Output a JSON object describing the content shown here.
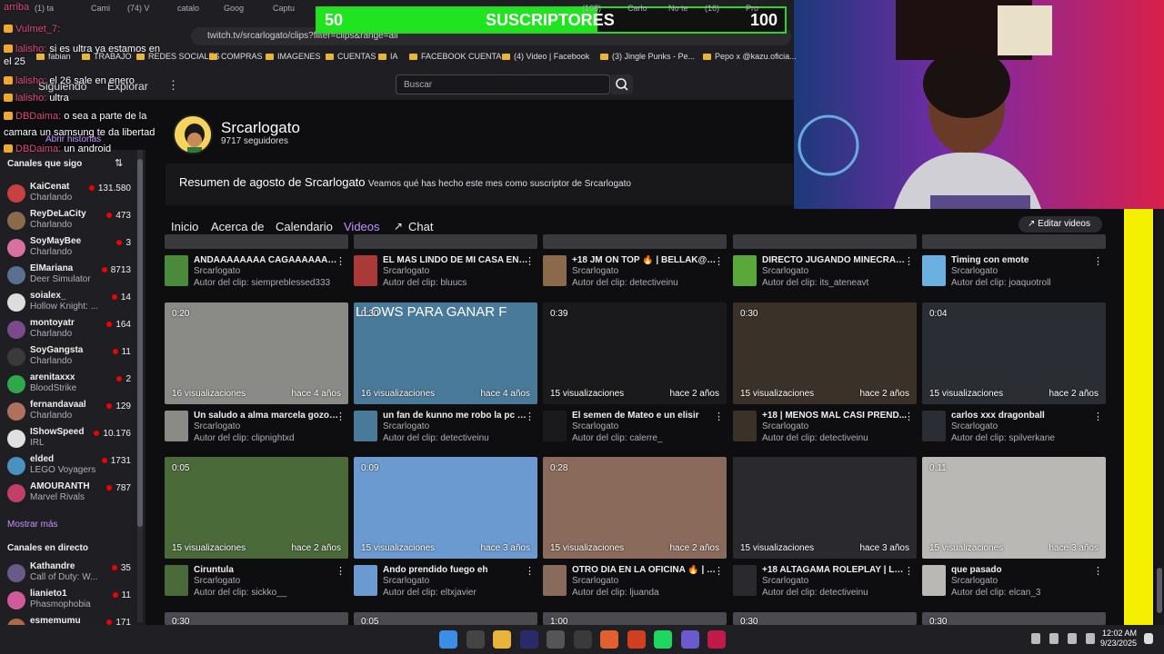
{
  "browser": {
    "tabs": [
      "(1) ta",
      "Cami",
      "(74) V",
      "catalo",
      "Goog",
      "Captu",
      "(108)",
      "Carlo",
      "No te",
      "(16)",
      "Pro"
    ],
    "url": "twitch.tv/srcarlogato/clips?filter=clips&range=all",
    "bookmarks": [
      "fabian",
      "TRABAJO",
      "REDES SOCIALES",
      "COMPRAS",
      "IMAGENES",
      "CUENTAS",
      "IA",
      "FACEBOOK CUENTA...",
      "(4) Video | Facebook",
      "(3) Jingle Punks - Pe...",
      "Pepo x @kazu.oficia..."
    ]
  },
  "subs_bar": {
    "left": "50",
    "center": "SUSCRIPTORES",
    "right": "100",
    "progress": 0.6
  },
  "chat": [
    {
      "user": "arriba",
      "msg": "",
      "badge": false
    },
    {
      "user": "Vulmet_7:",
      "msg": "",
      "badge": true
    },
    {
      "user": "lalisho:",
      "msg": "si es ultra ya estamos en",
      "badge": true
    },
    {
      "user": "",
      "msg": "el 25",
      "badge": false
    },
    {
      "user": "lalisho:",
      "msg": "el 26 sale en enero",
      "badge": true
    },
    {
      "user": "lalisho:",
      "msg": "ultra",
      "badge": true
    },
    {
      "user": "DBDaima:",
      "msg": "o sea a parte de la",
      "badge": true
    },
    {
      "user": "",
      "msg": "camara un samsung te da libertad",
      "badge": false
    },
    {
      "user": "DBDaima:",
      "msg": "un android",
      "badge": true
    }
  ],
  "nav_stub": {
    "following": "Siguiendo",
    "explore": "Explorar",
    "stories": "Abrir historias"
  },
  "search": {
    "placeholder": "Buscar"
  },
  "channel": {
    "name": "Srcarlogato",
    "followers": "9717 seguidores"
  },
  "recap": {
    "title": "Resumen de agosto de Srcarlogato",
    "desc": "Veamos qué has hecho este mes como suscriptor de Srcarlogato"
  },
  "tabs": [
    "Inicio",
    "Acerca de",
    "Calendario",
    "Videos",
    "Chat"
  ],
  "edit_videos": "Editar videos",
  "sidebar": {
    "followed_title": "Canales que sigo",
    "followed": [
      {
        "name": "KaiCenat",
        "game": "Charlando",
        "viewers": "131.580",
        "color": "#c94040"
      },
      {
        "name": "ReyDeLaCity",
        "game": "Charlando",
        "viewers": "473",
        "color": "#8a6a4a"
      },
      {
        "name": "SoyMayBee",
        "game": "Charlando",
        "viewers": "3",
        "color": "#d870a0"
      },
      {
        "name": "ElMariana",
        "game": "Deer Simulator",
        "viewers": "8713",
        "color": "#5a7090"
      },
      {
        "name": "soialex_",
        "game": "Hollow Knight: ...",
        "viewers": "14",
        "color": "#dddddd"
      },
      {
        "name": "montoyatr",
        "game": "Charlando",
        "viewers": "164",
        "color": "#7a4a8a"
      },
      {
        "name": "SoyGangsta",
        "game": "Charlando",
        "viewers": "11",
        "color": "#3a3a3a"
      },
      {
        "name": "arenitaxxx",
        "game": "BloodStrike",
        "viewers": "2",
        "color": "#2ea84a"
      },
      {
        "name": "fernandavaal",
        "game": "Charlando",
        "viewers": "129",
        "color": "#b07060"
      },
      {
        "name": "IShowSpeed",
        "game": "IRL",
        "viewers": "10.176",
        "color": "#e0e0e0"
      },
      {
        "name": "elded",
        "game": "LEGO Voyagers",
        "viewers": "1731",
        "color": "#4a90c0"
      },
      {
        "name": "AMOURANTH",
        "game": "Marvel Rivals",
        "viewers": "787",
        "color": "#c0406a"
      }
    ],
    "show_more": "Mostrar más",
    "live_title": "Canales en directo",
    "live": [
      {
        "name": "Kathandre",
        "game": "Call of Duty: W...",
        "viewers": "35",
        "color": "#6a5a8a"
      },
      {
        "name": "lianieto1",
        "game": "Phasmophobia",
        "viewers": "11",
        "color": "#d05a9a"
      },
      {
        "name": "esmemumu",
        "game": "",
        "viewers": "171",
        "color": "#aa6a4a"
      }
    ]
  },
  "clips_top_row": [
    {
      "title": "ANDAAAAAAAA CAGAAAAAAAA...",
      "channel": "Srcarlogato",
      "by": "Autor del clip: siempreblessed333"
    },
    {
      "title": "EL MAS LINDO DE MI CASA EN T...",
      "channel": "Srcarlogato",
      "by": "Autor del clip: bluucs"
    },
    {
      "title": "+18 JM ON TOP 🔥 | BELLAK@S ...",
      "channel": "Srcarlogato",
      "by": "Autor del clip: detectiveinu"
    },
    {
      "title": "DIRECTO JUGANDO MINECRAF...",
      "channel": "Srcarlogato",
      "by": "Autor del clip: its_ateneavt"
    },
    {
      "title": "Timing con emote",
      "channel": "Srcarlogato",
      "by": "Autor del clip: joaquotroll"
    }
  ],
  "clips": [
    {
      "dur": "0:20",
      "views": "16 visualizaciones",
      "age": "hace 4 años",
      "title": "Un saludo a alma marcela gozo ...",
      "channel": "Srcarlogato",
      "by": "Autor del clip: clipnightxd",
      "bg": "#8a8a86"
    },
    {
      "dur": "0:30",
      "views": "16 visualizaciones",
      "age": "hace 4 años",
      "title": "un fan de kunno me robo la pc !r...",
      "channel": "Srcarlogato",
      "by": "Autor del clip: detectiveinu",
      "bg": "#4a7a9a",
      "overlay": "LLOWS PARA GANAR F"
    },
    {
      "dur": "0:39",
      "views": "15 visualizaciones",
      "age": "hace 2 años",
      "title": "El semen de Mateo e un elisir",
      "channel": "Srcarlogato",
      "by": "Autor del clip: calerre_",
      "bg": "#1a1a1c"
    },
    {
      "dur": "0:30",
      "views": "15 visualizaciones",
      "age": "hace 2 años",
      "title": "+18 | MENOS MAL CASI PREND...",
      "channel": "Srcarlogato",
      "by": "Autor del clip: detectiveinu",
      "bg": "#3a3228"
    },
    {
      "dur": "0:04",
      "views": "15 visualizaciones",
      "age": "hace 2 años",
      "title": "carlos xxx dragonball",
      "channel": "Srcarlogato",
      "by": "Autor del clip: spilverkane",
      "bg": "#2a2d33"
    },
    {
      "dur": "0:05",
      "views": "15 visualizaciones",
      "age": "hace 2 años",
      "title": "Ciruntula",
      "channel": "Srcarlogato",
      "by": "Autor del clip: sickko__",
      "bg": "#4a6a3a"
    },
    {
      "dur": "0:09",
      "views": "15 visualizaciones",
      "age": "hace 3 años",
      "title": "Ando prendido fuego eh",
      "channel": "Srcarlogato",
      "by": "Autor del clip: eltxjavier",
      "bg": "#6a9ad0"
    },
    {
      "dur": "0:28",
      "views": "15 visualizaciones",
      "age": "hace 2 años",
      "title": "OTRO DIA EN LA OFICINA 🔥 | C...",
      "channel": "Srcarlogato",
      "by": "Autor del clip: ljuanda",
      "bg": "#8a6a5a"
    },
    {
      "dur": "",
      "views": "15 visualizaciones",
      "age": "hace 3 años",
      "title": "+18 ALTAGAMA ROLEPLAY | LLE...",
      "channel": "Srcarlogato",
      "by": "Autor del clip: detectiveinu",
      "bg": "#2a2a2e"
    },
    {
      "dur": "0:11",
      "views": "15 visualizaciones",
      "age": "hace 3 años",
      "title": "que pasado",
      "channel": "Srcarlogato",
      "by": "Autor del clip: elcan_3",
      "bg": "#bab8b4"
    }
  ],
  "clips_bottom_durs": [
    "0:30",
    "0:05",
    "1:00",
    "0:30",
    "0:30"
  ],
  "clock": {
    "time": "12:02 AM",
    "date": "9/23/2025"
  },
  "colors": {
    "accent": "#bf94ff",
    "live": "#eb0400",
    "subs": "#1fe41f",
    "twitch_bg": "#0e0e10"
  }
}
